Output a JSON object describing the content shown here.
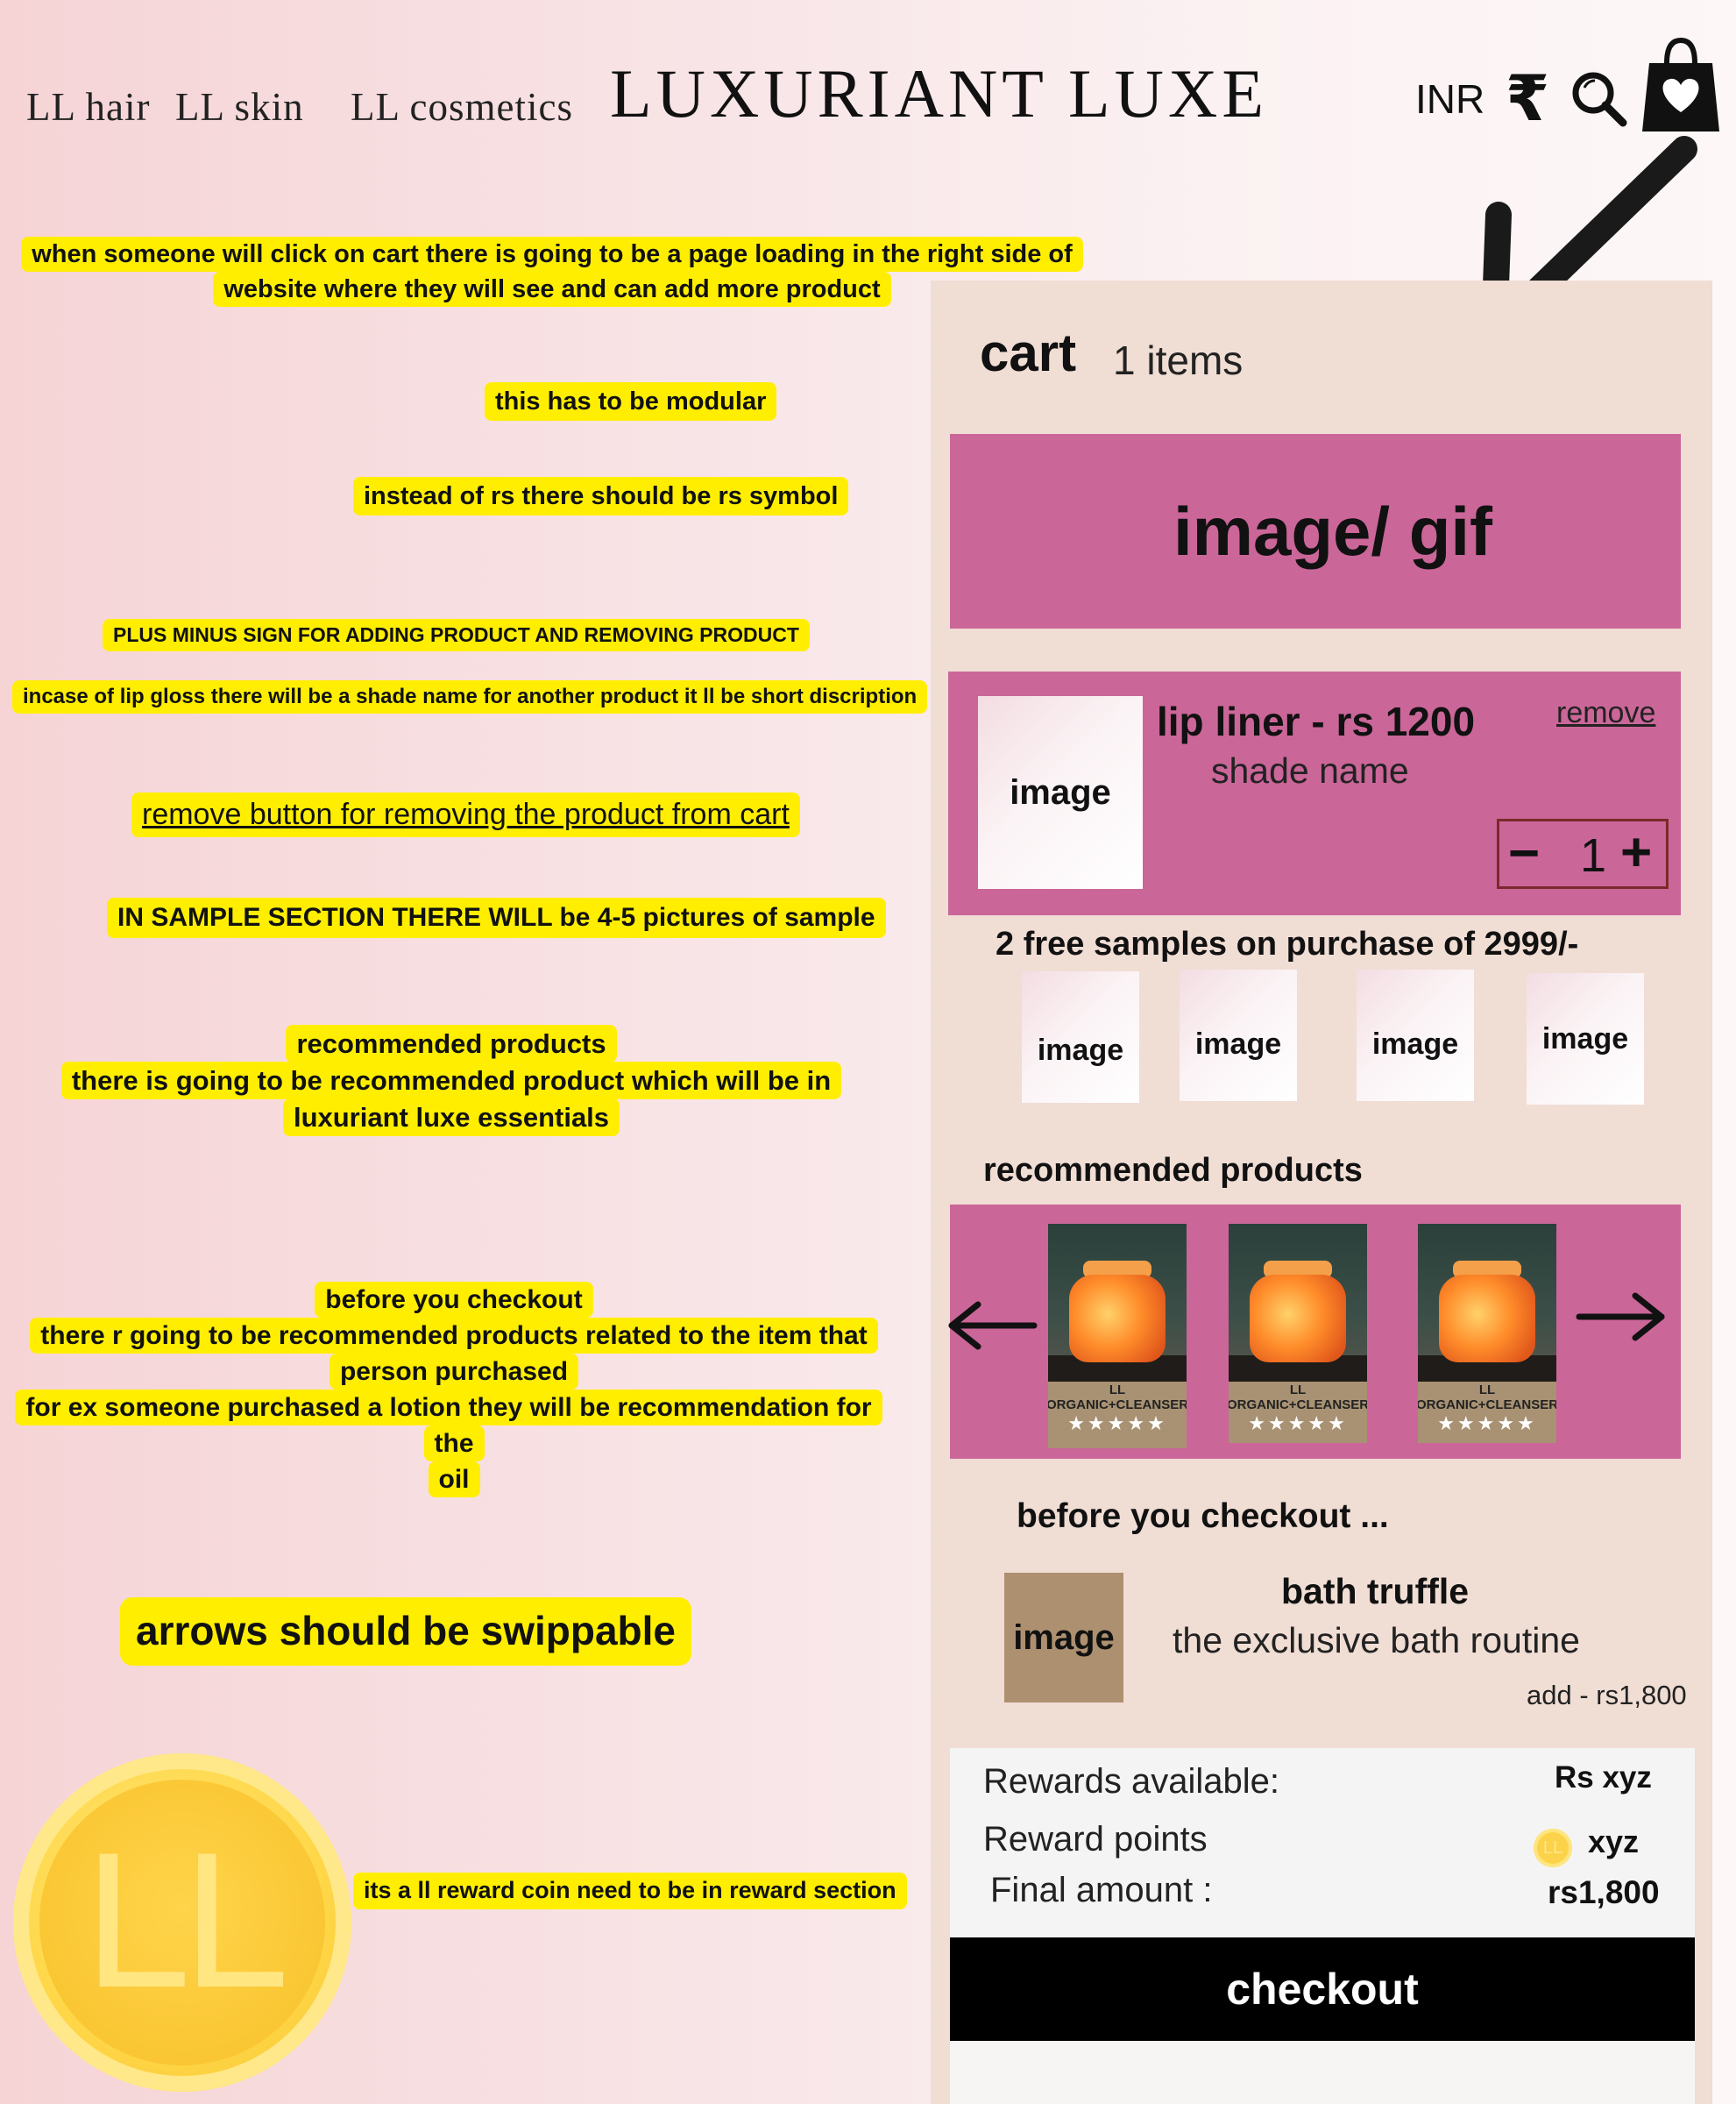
{
  "header": {
    "nav": [
      "LL hair",
      "LL skin",
      "LL cosmetics"
    ],
    "brand": "LUXURIANT LUXE",
    "currency": "INR",
    "currency_symbol": "₹"
  },
  "notes": {
    "cart_page": [
      "when someone will click on cart there is going to be a page loading in the right side of",
      "website where they will see and can add more product"
    ],
    "modular": "this has to be modular",
    "rs_symbol": "instead of rs there should be rs symbol",
    "plus_minus": "PLUS MINUS SIGN FOR ADDING PRODUCT AND REMOVING PRODUCT",
    "shade": "incase of lip gloss there will be a shade name for another product it ll be short discription",
    "remove_button": "remove button for removing the product from cart",
    "samples": "IN SAMPLE SECTION THERE WILL  be 4-5 pictures of sample",
    "recommended": [
      "recommended products",
      "there is going to be recommended product which will be in",
      "luxuriant luxe essentials"
    ],
    "before_checkout": [
      "before you checkout",
      "there r going to be recommended products related to the item that",
      "person purchased",
      "for ex someone purchased a lotion they will be recommendation for the",
      "oil"
    ],
    "swipe": "arrows should be swippable",
    "reward_coin": "its a ll reward coin need to be in reward section"
  },
  "coin": {
    "letters": "LL"
  },
  "cart": {
    "title": "cart",
    "count": "1 items",
    "banner": "image/ gif",
    "item": {
      "image": "image",
      "title": "lip liner - rs 1200",
      "shade": "shade name",
      "remove": "remove",
      "minus": "−",
      "qty": "1",
      "plus": "+"
    },
    "samples_title": "2 free samples on purchase of 2999/-",
    "samples": [
      "image",
      "image",
      "image",
      "image"
    ],
    "recommended_title": "recommended products",
    "recommended": [
      {
        "line1": "LL",
        "line2": "ORGANIC+CLEANSER",
        "stars": "★★★★★"
      },
      {
        "line1": "LL",
        "line2": "ORGANIC+CLEANSER",
        "stars": "★★★★★"
      },
      {
        "line1": "LL",
        "line2": "ORGANIC+CLEANSER",
        "stars": "★★★★★"
      }
    ],
    "before_title": "before you checkout ...",
    "upsell": {
      "image": "image",
      "name": "bath truffle",
      "desc": "the exclusive bath routine",
      "add": "add - rs1,800"
    },
    "summary": {
      "rewards_label": "Rewards available:",
      "rewards_value": "Rs xyz",
      "points_label": "Reward points",
      "points_coin": "LL",
      "points_value": "xyz",
      "final_label": "Final amount :",
      "final_value": "rs1,800"
    },
    "checkout": "checkout"
  },
  "icons": [
    "search-icon",
    "shopping-bag-heart-icon",
    "rupee-icon",
    "arrow-left-icon",
    "arrow-right-icon",
    "pointer-arrow-icon",
    "reward-coin-icon"
  ]
}
